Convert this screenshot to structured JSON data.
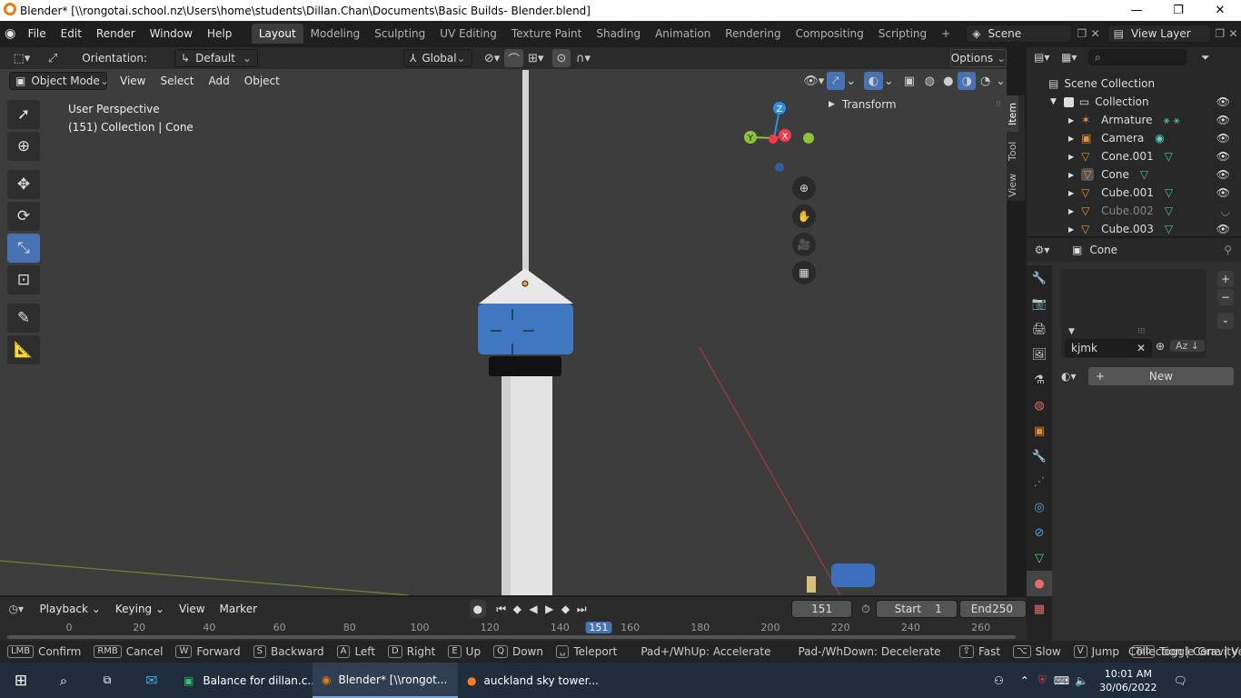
{
  "window": {
    "title": "Blender* [\\\\rongotai.school.nz\\Users\\home\\students\\Dillan.Chan\\Documents\\Basic Builds- Blender.blend]",
    "minimize": "—",
    "restore": "❐",
    "close": "✕"
  },
  "topmenu": {
    "items": [
      "File",
      "Edit",
      "Render",
      "Window",
      "Help"
    ],
    "workspaces": [
      "Layout",
      "Modeling",
      "Sculpting",
      "UV Editing",
      "Texture Paint",
      "Shading",
      "Animation",
      "Rendering",
      "Compositing",
      "Scripting"
    ],
    "active_workspace": "Layout",
    "add_workspace": "+",
    "scene_label": "Scene",
    "view_layer_label": "View Layer"
  },
  "viewport_header": {
    "orientation_label": "Orientation:",
    "orientation_value": "Default",
    "transform_orientation": "Global",
    "options_label": "Options",
    "mode": "Object Mode",
    "menus": [
      "View",
      "Select",
      "Add",
      "Object"
    ]
  },
  "viewport": {
    "perspective_text": "User Perspective",
    "collection_text": "(151) Collection | Cone",
    "transform_panel": "Transform",
    "side_tabs": [
      "Item",
      "Tool",
      "View"
    ],
    "gizmo_axes": {
      "x": "X",
      "y": "Y",
      "z": "Z"
    },
    "colors": {
      "x_axis": "#f53a4c",
      "y_axis": "#8bc33a",
      "z_axis": "#2f8fe6",
      "tower_blue": "#3f78c0"
    }
  },
  "tools": [
    "select-box-icon",
    "cursor-icon",
    "move-icon",
    "rotate-icon",
    "scale-icon",
    "transform-icon",
    "annotate-icon",
    "measure-icon"
  ],
  "outliner": {
    "root": "Scene Collection",
    "collection": "Collection",
    "items": [
      {
        "name": "Armature",
        "dim": false
      },
      {
        "name": "Camera",
        "dim": false
      },
      {
        "name": "Cone.001",
        "dim": false
      },
      {
        "name": "Cone",
        "dim": false,
        "active": true
      },
      {
        "name": "Cube.001",
        "dim": false
      },
      {
        "name": "Cube.002",
        "dim": true
      },
      {
        "name": "Cube.003",
        "dim": false
      }
    ]
  },
  "properties": {
    "object_name": "Cone",
    "material_slot_name": "kjmk",
    "new_button": "New",
    "plus": "+",
    "minus": "−"
  },
  "timeline": {
    "menus": [
      "Playback",
      "Keying",
      "View",
      "Marker"
    ],
    "current_frame": "151",
    "start_label": "Start",
    "start_value": "1",
    "end_label": "End",
    "end_value": "250",
    "ruler_ticks": [
      "0",
      "20",
      "40",
      "60",
      "80",
      "100",
      "120",
      "140",
      "160",
      "180",
      "200",
      "220",
      "240",
      "260"
    ],
    "playhead": "151"
  },
  "statusbar": {
    "items": [
      {
        "key": "LMB",
        "label": "Confirm"
      },
      {
        "key": "RMB",
        "label": "Cancel"
      },
      {
        "key": "W",
        "label": "Forward"
      },
      {
        "key": "S",
        "label": "Backward"
      },
      {
        "key": "A",
        "label": "Left"
      },
      {
        "key": "D",
        "label": "Right"
      },
      {
        "key": "E",
        "label": "Up"
      },
      {
        "key": "Q",
        "label": "Down"
      },
      {
        "key": "␣",
        "label": "Teleport"
      }
    ],
    "accelerate": "Pad+/WhUp: Accelerate",
    "decelerate": "Pad-/WhDown: Decelerate",
    "items2": [
      {
        "key": "⇧",
        "label": "Fast"
      },
      {
        "key": "⌥",
        "label": "Slow"
      },
      {
        "key": "V",
        "label": "Jump"
      },
      {
        "key": "Tab",
        "label": "Toggle Gravity"
      }
    ],
    "right": "Collection | Cone | Verts:"
  },
  "taskbar": {
    "apps": [
      {
        "label": "Balance for dillan.c...",
        "active": false
      },
      {
        "label": "Blender* [\\\\rongot...",
        "active": true
      },
      {
        "label": "auckland sky tower...",
        "active": false
      }
    ],
    "time": "10:01 AM",
    "date": "30/06/2022"
  }
}
